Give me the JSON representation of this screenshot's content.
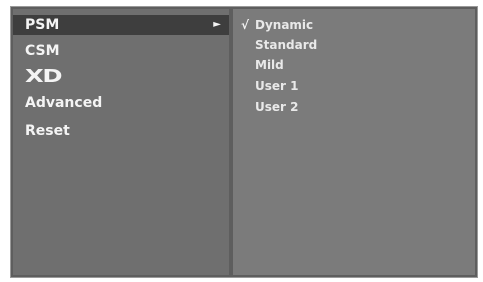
{
  "menu": {
    "items": [
      {
        "label": "PSM",
        "selected": true
      },
      {
        "label": "CSM"
      },
      {
        "label": "XD",
        "logo": true
      },
      {
        "label": "Advanced"
      },
      {
        "label": "Reset"
      }
    ],
    "arrow_glyph": "►"
  },
  "submenu": {
    "check_glyph": "√",
    "options": [
      {
        "label": "Dynamic",
        "checked": true
      },
      {
        "label": "Standard"
      },
      {
        "label": "Mild"
      },
      {
        "label": "User 1"
      },
      {
        "label": "User 2"
      }
    ]
  }
}
